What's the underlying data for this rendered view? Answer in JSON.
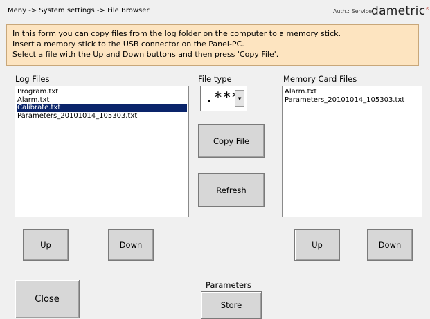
{
  "header": {
    "breadcrumb": "Meny -> System settings -> File Browser",
    "auth": "Auth.: Service",
    "logo": "dametric"
  },
  "info": {
    "lines": [
      "In this form you can copy files from the log folder on the computer to a memory stick.",
      "Insert a memory stick to the USB connector on the Panel-PC.",
      "Select a file with the Up and Down buttons and then press 'Copy File'."
    ]
  },
  "log_files": {
    "title": "Log Files",
    "items": [
      "Program.txt",
      "Alarm.txt",
      "Calibrate.txt",
      "Parameters_20101014_105303.txt"
    ],
    "selected_index": 2
  },
  "file_type": {
    "title": "File type",
    "value": ".***",
    "arrow": "▼"
  },
  "memory_card": {
    "title": "Memory Card Files",
    "items": [
      "Alarm.txt",
      "Parameters_20101014_105303.txt"
    ]
  },
  "buttons": {
    "copy_file": "Copy File",
    "refresh": "Refresh",
    "log_up": "Up",
    "log_down": "Down",
    "mem_up": "Up",
    "mem_down": "Down",
    "close": "Close",
    "store": "Store"
  },
  "parameters": {
    "label": "Parameters"
  },
  "colors": {
    "info_bg": "#fde4c0",
    "selection": "#0a246a",
    "button_bg": "#d7d7d7"
  }
}
